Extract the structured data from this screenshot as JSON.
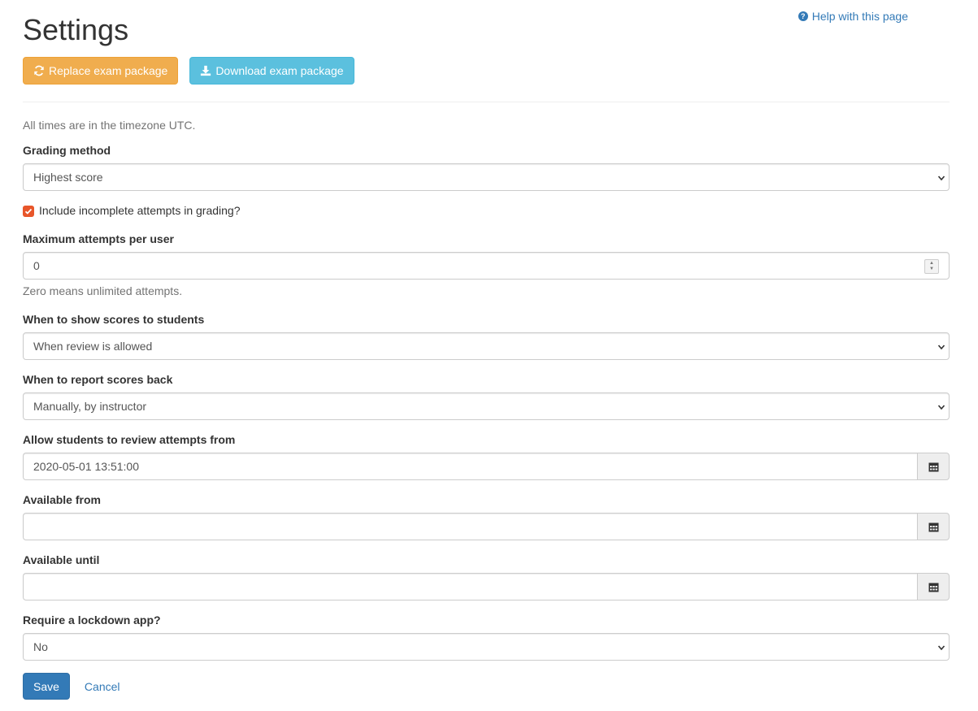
{
  "header": {
    "title": "Settings",
    "help_link": "Help with this page",
    "replace_button": "Replace exam package",
    "download_button": "Download exam package"
  },
  "form": {
    "timezone_note": "All times are in the timezone UTC.",
    "grading_method": {
      "label": "Grading method",
      "value": "Highest score"
    },
    "include_incomplete": {
      "label": "Include incomplete attempts in grading?",
      "checked": true
    },
    "max_attempts": {
      "label": "Maximum attempts per user",
      "value": "0",
      "help": "Zero means unlimited attempts."
    },
    "show_scores": {
      "label": "When to show scores to students",
      "value": "When review is allowed"
    },
    "report_scores": {
      "label": "When to report scores back",
      "value": "Manually, by instructor"
    },
    "review_from": {
      "label": "Allow students to review attempts from",
      "value": "2020-05-01 13:51:00"
    },
    "available_from": {
      "label": "Available from",
      "value": ""
    },
    "available_until": {
      "label": "Available until",
      "value": ""
    },
    "lockdown": {
      "label": "Require a lockdown app?",
      "value": "No"
    }
  },
  "actions": {
    "save": "Save",
    "cancel": "Cancel"
  },
  "colors": {
    "primary": "#337ab7",
    "warning": "#f0ad4e",
    "info": "#5bc0de",
    "checkbox": "#e8562a"
  },
  "icons": {
    "help": "question-circle-icon",
    "replace": "refresh-icon",
    "download": "download-icon",
    "calendar": "calendar-icon",
    "select": "chevron-down-icon"
  }
}
